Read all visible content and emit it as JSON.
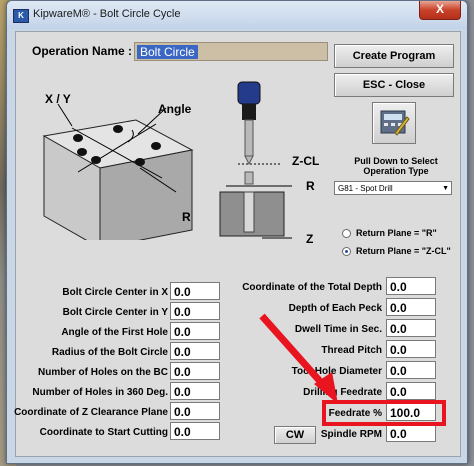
{
  "window": {
    "title": "KipwareM® - Bolt Circle Cycle",
    "close_glyph": "X"
  },
  "operation": {
    "label": "Operation Name :",
    "value": "Bolt Circle"
  },
  "buttons": {
    "create_program": "Create Program",
    "esc_close": "ESC - Close",
    "cw": "CW"
  },
  "diagram": {
    "xy_label": "X / Y",
    "angle_label": "Angle",
    "r_label": "R",
    "z_cl_label": "Z-CL",
    "r_side_label": "R",
    "z_label": "Z"
  },
  "operation_type": {
    "heading_line1": "Pull Down to Select",
    "heading_line2": "Operation Type",
    "selected": "G81 - Spot Drill"
  },
  "return_plane": {
    "option_r": "Return Plane = \"R\"",
    "option_zcl": "Return Plane = \"Z-CL\"",
    "selected": "Z-CL"
  },
  "left_fields": [
    {
      "label": "Bolt Circle Center in X",
      "value": "0.0"
    },
    {
      "label": "Bolt Circle Center in Y",
      "value": "0.0"
    },
    {
      "label": "Angle of the First Hole",
      "value": "0.0"
    },
    {
      "label": "Radius of the Bolt Circle",
      "value": "0.0"
    },
    {
      "label": "Number of Holes on the BC",
      "value": "0.0"
    },
    {
      "label": "Number of Holes in 360 Deg.",
      "value": "0.0"
    },
    {
      "label": "Coordinate of Z Clearance Plane",
      "value": "0.0"
    },
    {
      "label": "Coordinate to Start Cutting",
      "value": "0.0"
    }
  ],
  "right_fields": [
    {
      "label": "Coordinate of the Total Depth",
      "value": "0.0"
    },
    {
      "label": "Depth of Each Peck",
      "value": "0.0"
    },
    {
      "label": "Dwell Time in Sec.",
      "value": "0.0"
    },
    {
      "label": "Thread Pitch",
      "value": "0.0"
    },
    {
      "label": "Tool Hole Diameter",
      "value": "0.0"
    },
    {
      "label": "Drilling Feedrate",
      "value": "0.0"
    },
    {
      "label": "Feedrate %",
      "value": "100.0"
    },
    {
      "label": "Spindle RPM",
      "value": "0.0"
    }
  ],
  "colors": {
    "highlight": "#e8141f",
    "arrow": "#e8141f",
    "selection": "#3b67c4"
  }
}
